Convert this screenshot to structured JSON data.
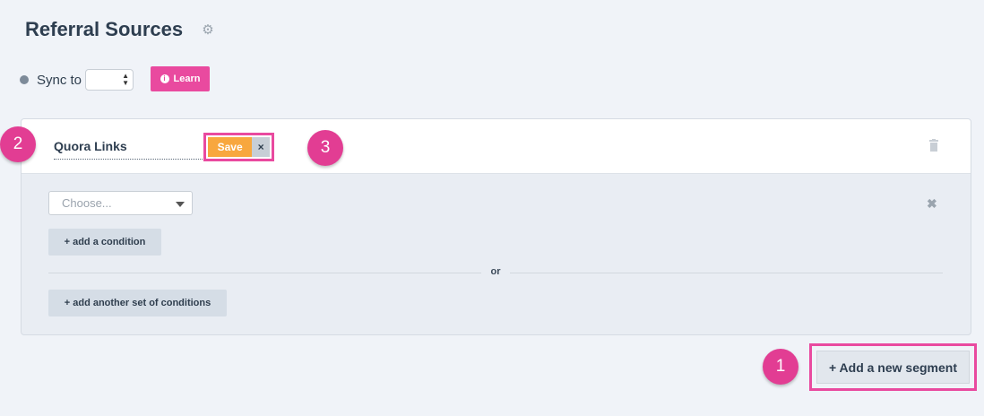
{
  "page": {
    "title": "Referral Sources"
  },
  "icons": {
    "settings": "gear-icon",
    "info": "info-icon",
    "trash": "trash-icon",
    "close": "close-icon"
  },
  "sync": {
    "label": "Sync to",
    "value": ""
  },
  "learn": {
    "label": "Learn",
    "info_glyph": "i"
  },
  "segment": {
    "name": "Quora Links",
    "save_label": "Save",
    "cancel_glyph": "×",
    "choose_placeholder": "Choose...",
    "add_condition_label": "+ add a condition",
    "or_label": "or",
    "add_set_label": "+ add another set of conditions"
  },
  "add_segment": {
    "label": "+ Add a new segment"
  },
  "annotations": {
    "badge_1": "1",
    "badge_2": "2",
    "badge_3": "3"
  },
  "colors": {
    "accent_pink": "#e94a9f",
    "save_orange": "#f8a73e",
    "background": "#f0f3f8"
  }
}
